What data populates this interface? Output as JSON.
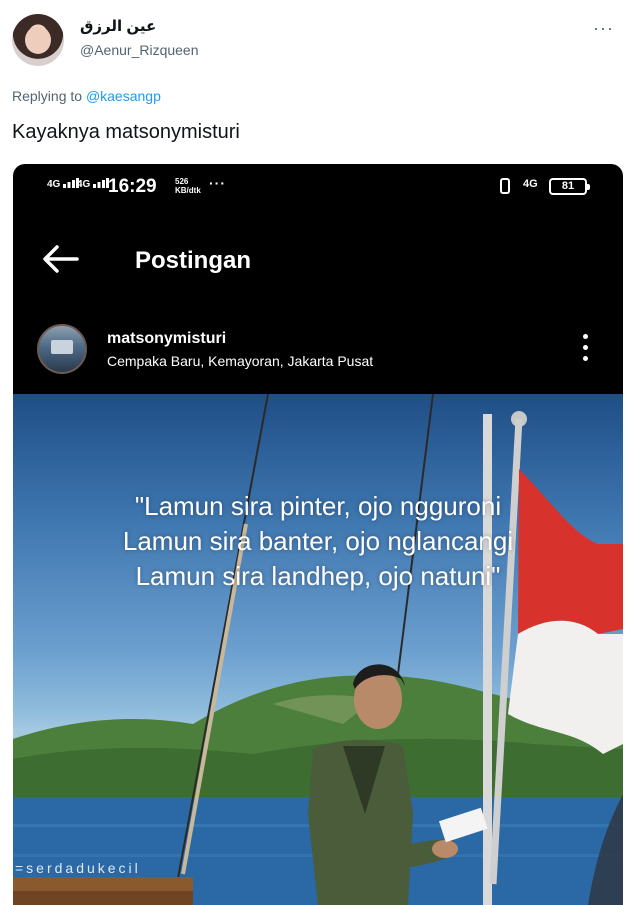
{
  "tweet": {
    "display_name": "عين الرزق",
    "handle": "@Aenur_Rizqueen",
    "more_label": "···",
    "replying_prefix": "Replying to",
    "replying_to": "@kaesangp",
    "text": "Kayaknya matsonymisturi"
  },
  "phone_status": {
    "signal1": "4G",
    "signal2": "4G",
    "time": "16:29",
    "speed_value": "526",
    "speed_unit": "KB/dtk",
    "dots": "···",
    "network": "4G",
    "battery": "81"
  },
  "instagram": {
    "page_title": "Postingan",
    "username": "matsonymisturi",
    "location": "Cempaka Baru, Kemayoran, Jakarta Pusat"
  },
  "photo": {
    "quote_lines": [
      "\"Lamun sira pinter, ojo ngguroni",
      "Lamun sira banter, ojo nglancangi",
      "Lamun sira landhep, ojo natuni\""
    ],
    "watermark": "=serdadukecil"
  },
  "colors": {
    "link_blue": "#1d9bf0",
    "muted_gray": "#536471",
    "flag_red": "#d8322c"
  },
  "icons": {
    "back": "arrow-left-icon",
    "more": "vertical-dots-icon",
    "vibrate": "vibrate-icon",
    "battery": "battery-icon"
  }
}
